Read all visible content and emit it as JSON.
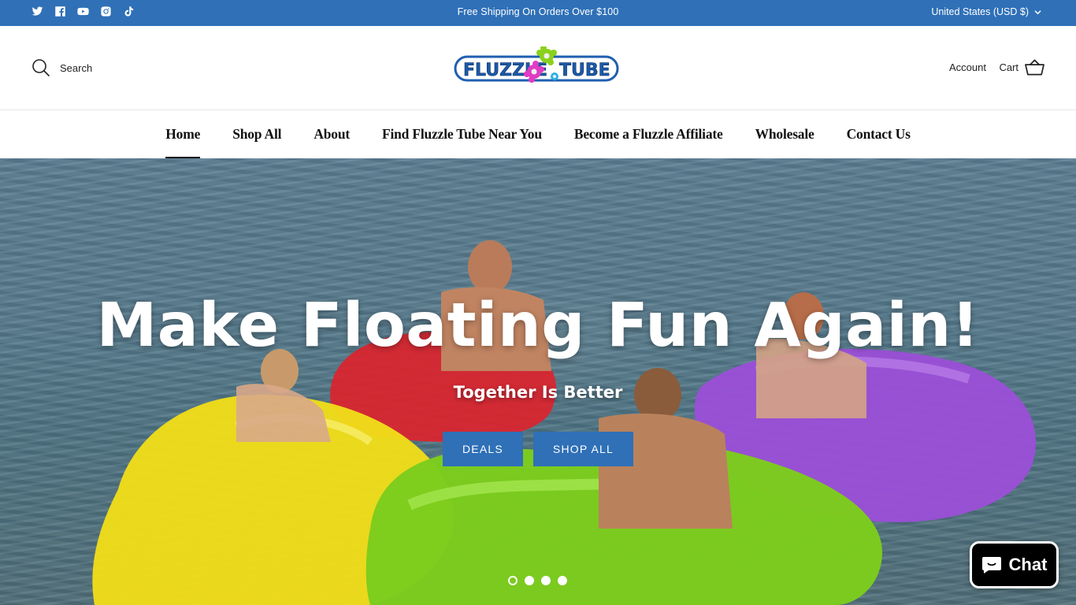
{
  "topbar": {
    "social_icons": [
      "twitter-icon",
      "facebook-icon",
      "youtube-icon",
      "instagram-icon",
      "tiktok-icon"
    ],
    "announcement": "Free Shipping On Orders Over $100",
    "currency": "United States (USD $)",
    "background_color": "#2f70b7"
  },
  "header": {
    "search_label": "Search",
    "logo_text": "FLUZZLE TUBE",
    "account_label": "Account",
    "cart_label": "Cart"
  },
  "nav": {
    "items": [
      {
        "label": "Home",
        "active": true
      },
      {
        "label": "Shop All",
        "active": false
      },
      {
        "label": "About",
        "active": false
      },
      {
        "label": "Find Fluzzle Tube Near You",
        "active": false
      },
      {
        "label": "Become a Fluzzle Affiliate",
        "active": false
      },
      {
        "label": "Wholesale",
        "active": false
      },
      {
        "label": "Contact Us",
        "active": false
      }
    ]
  },
  "hero": {
    "title": "Make Floating Fun Again!",
    "subtitle": "Together Is Better",
    "buttons": [
      "DEALS",
      "SHOP ALL"
    ],
    "slide_count": 4,
    "active_slide": 1,
    "button_color": "#2f70b7"
  },
  "chat": {
    "label": "Chat"
  }
}
